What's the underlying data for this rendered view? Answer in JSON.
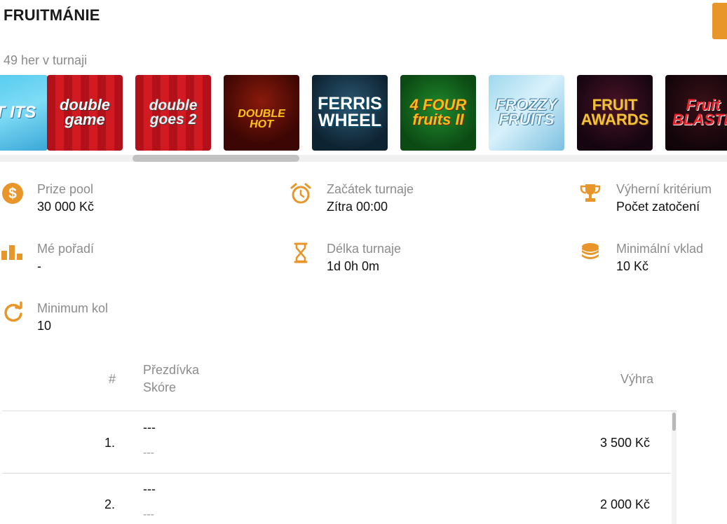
{
  "header": {
    "title": "FRUITMÁNIE",
    "accent_color": "#e8962a"
  },
  "games": {
    "count_label": "49 her v turnaji",
    "tiles": [
      {
        "name": "ET ITS",
        "icon": "game-thumbnail"
      },
      {
        "name": "double game",
        "icon": "game-thumbnail"
      },
      {
        "name": "double goes 2",
        "icon": "game-thumbnail"
      },
      {
        "name": "DOUBLE HOT",
        "icon": "game-thumbnail"
      },
      {
        "name": "FERRIS WHEEL",
        "icon": "game-thumbnail"
      },
      {
        "name": "4 FOUR fruits II",
        "icon": "game-thumbnail"
      },
      {
        "name": "FROZZY FRUITS",
        "icon": "game-thumbnail"
      },
      {
        "name": "FRUIT AWARDS",
        "icon": "game-thumbnail"
      },
      {
        "name": "Fruit BLASTE",
        "icon": "game-thumbnail"
      }
    ]
  },
  "info": {
    "prize_pool": {
      "label": "Prize pool",
      "value": "30 000 Kč",
      "icon": "dollar-coin-icon"
    },
    "start": {
      "label": "Začátek turnaje",
      "value": "Zítra 00:00",
      "icon": "alarm-clock-icon"
    },
    "criterion": {
      "label": "Výherní kritérium",
      "value": "Počet zatočení",
      "icon": "trophy-icon"
    },
    "rank": {
      "label": "Mé pořadí",
      "value": "-",
      "icon": "bar-chart-icon"
    },
    "duration": {
      "label": "Délka turnaje",
      "value": "1d 0h 0m",
      "icon": "hourglass-icon"
    },
    "min_deposit": {
      "label": "Minimální vklad",
      "value": "10 Kč",
      "icon": "coin-stack-icon"
    },
    "min_rounds": {
      "label": "Minimum kol",
      "value": "10",
      "icon": "refresh-icon"
    }
  },
  "leaderboard": {
    "headers": {
      "rank": "#",
      "nickname": "Přezdívka",
      "score": "Skóre",
      "prize": "Výhra"
    },
    "rows": [
      {
        "rank": "1.",
        "nickname": "---",
        "score": "---",
        "prize": "3 500 Kč"
      },
      {
        "rank": "2.",
        "nickname": "---",
        "score": "---",
        "prize": "2 000 Kč"
      }
    ]
  }
}
